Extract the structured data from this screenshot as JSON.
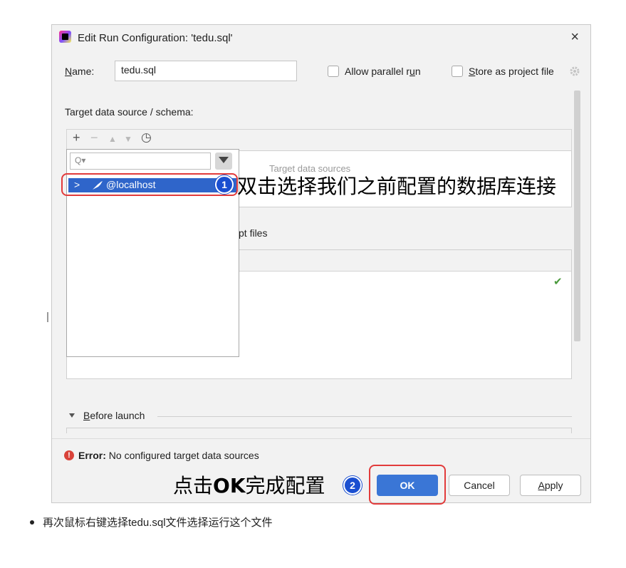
{
  "dialog": {
    "title": "Edit Run Configuration: 'tedu.sql'",
    "close_glyph": "×",
    "name_label_first": "N",
    "name_label_rest": "ame:",
    "name_value": "tedu.sql",
    "allow_parallel_pre": "Allow parallel r",
    "allow_parallel_u": "u",
    "allow_parallel_post": "n",
    "store_u": "S",
    "store_rest": "tore as project file",
    "target_label": "Target data source / schema:",
    "toolbar": {
      "add": "+",
      "remove": "−",
      "up": "▲",
      "down": "▼",
      "history": "◷"
    },
    "popup": {
      "search_placeholder": "Q▾",
      "row_chevron": ">",
      "row_label": "@localhost"
    },
    "hint_target": "Target data sources",
    "script_files_label": "pt files",
    "checkmark": "✔",
    "before_launch_u": "B",
    "before_launch_rest": "efore launch",
    "error_label": "Error:",
    "error_message": " No configured target data sources",
    "buttons": {
      "ok": "OK",
      "cancel": "Cancel",
      "apply_u": "A",
      "apply_rest": "pply"
    }
  },
  "annotations": {
    "step1_number": "1",
    "step1_text": "双击选择我们之前配置的数据库连接",
    "step2_number": "2",
    "step2_text_a": "点击",
    "step2_text_b": "OK",
    "step2_text_c": "完成配置"
  },
  "bullet_text": "再次鼠标右键选择tedu.sql文件选择运行这个文件",
  "colors": {
    "accent": "#3a76d6",
    "selection": "#2f65ca",
    "highlight": "#e23b3b",
    "badge": "#1a4fd0",
    "error": "#d9433a",
    "check": "#4a9a3c"
  }
}
